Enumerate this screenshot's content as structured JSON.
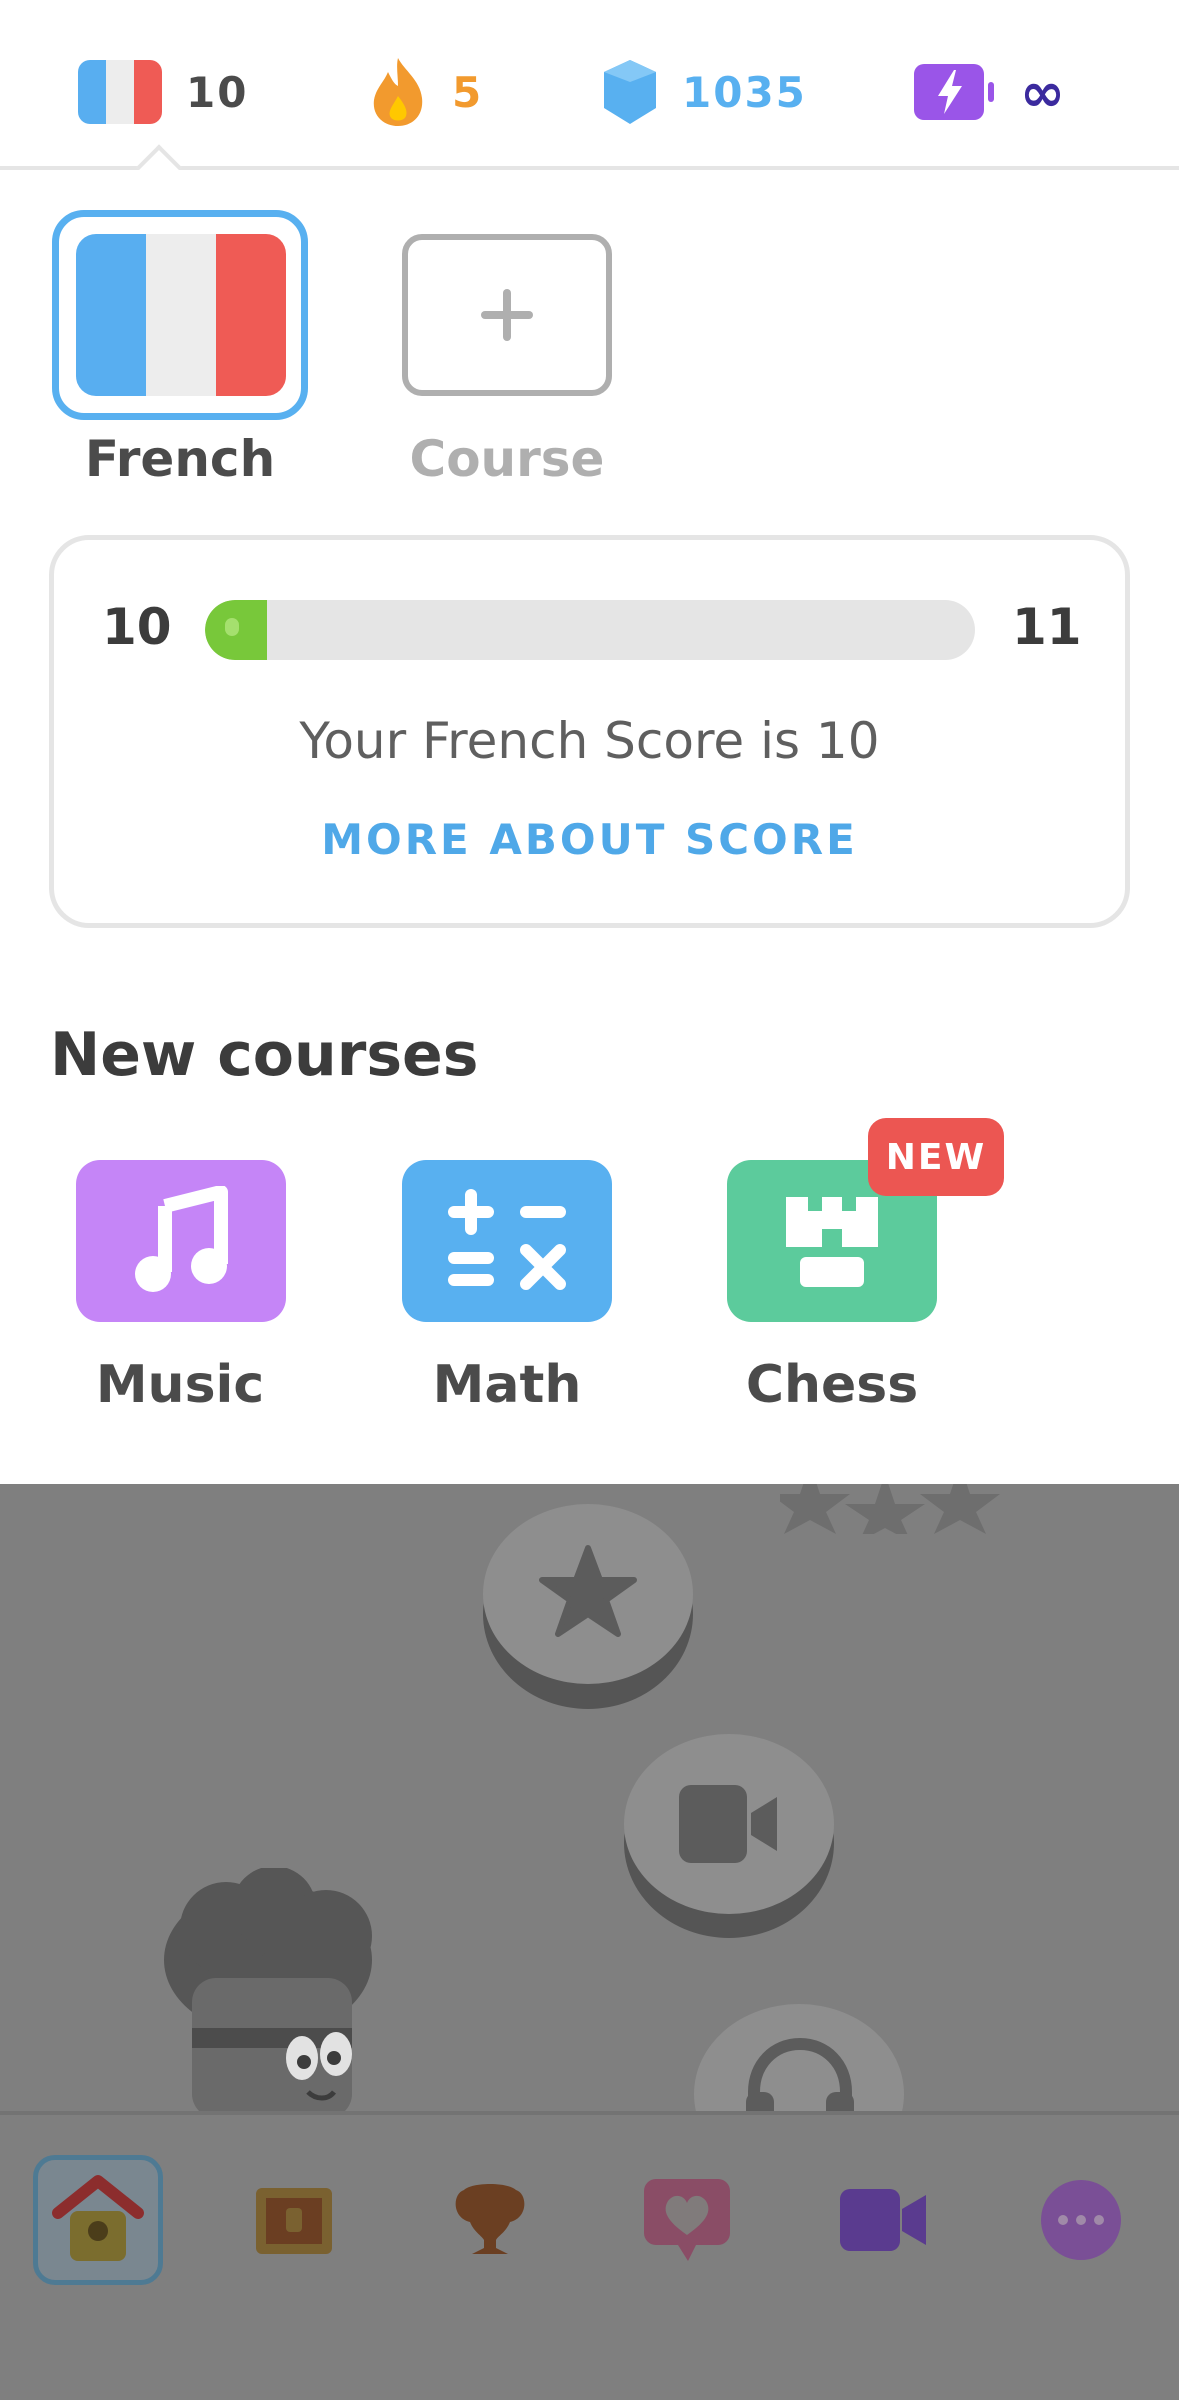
{
  "stats": {
    "language_level": "10",
    "streak": "5",
    "gems": "1035",
    "energy": "∞"
  },
  "courses": {
    "current": "French",
    "add_label": "Course"
  },
  "score": {
    "current": "10",
    "next": "11",
    "progress": 0.08,
    "message": "Your French Score is 10",
    "link": "MORE ABOUT SCORE"
  },
  "new_courses": {
    "title": "New courses",
    "items": [
      {
        "label": "Music"
      },
      {
        "label": "Math"
      },
      {
        "label": "Chess",
        "badge": "NEW"
      }
    ]
  },
  "colors": {
    "streak": "#f29a2e",
    "gems": "#58b0f0",
    "energy": "#9a55e8",
    "music": "#c585f7",
    "math": "#58b0f0",
    "chess": "#5ccb9c",
    "progress": "#78c83a"
  },
  "icons": [
    "french-flag-icon",
    "flame-icon",
    "gem-icon",
    "energy-battery-icon",
    "plus-icon",
    "music-note-icon",
    "math-symbols-icon",
    "chess-rook-icon",
    "home-icon",
    "treasure-chest-icon",
    "trophy-icon",
    "heart-chat-icon",
    "video-icon",
    "more-icon"
  ]
}
